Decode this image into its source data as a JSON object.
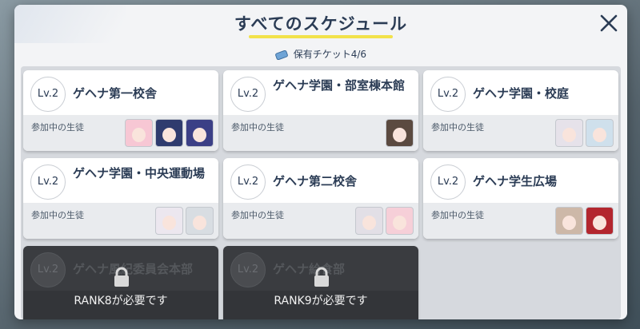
{
  "modal": {
    "title": "すべてのスケジュール",
    "ticket_label": "保有チケット4/6"
  },
  "cards": [
    {
      "level": "Lv.2",
      "title": "ゲヘナ第一校舎",
      "footer": "参加中の生徒",
      "avatars": 3
    },
    {
      "level": "Lv.2",
      "title": "ゲヘナ学園・部室棟本館",
      "footer": "参加中の生徒",
      "avatars": 1
    },
    {
      "level": "Lv.2",
      "title": "ゲヘナ学園・校庭",
      "footer": "参加中の生徒",
      "avatars": 2
    },
    {
      "level": "Lv.2",
      "title": "ゲヘナ学園・中央運動場",
      "footer": "参加中の生徒",
      "avatars": 2
    },
    {
      "level": "Lv.2",
      "title": "ゲヘナ第二校舎",
      "footer": "参加中の生徒",
      "avatars": 2
    },
    {
      "level": "Lv.2",
      "title": "ゲヘナ学生広場",
      "footer": "参加中の生徒",
      "avatars": 2
    }
  ],
  "locked_cards": [
    {
      "level": "Lv.2",
      "title": "ゲヘナ風紀委員会本部",
      "lock_text": "RANK8が必要です"
    },
    {
      "level": "Lv.2",
      "title": "ゲヘナ給食部",
      "lock_text": "RANK9が必要です"
    }
  ],
  "icons": {
    "close": "close-icon",
    "ticket": "ticket-icon",
    "lock": "lock-icon"
  },
  "colors": {
    "title": "#2b3c55",
    "underline": "#f2e24a",
    "heart": "#ff4f86",
    "locked_bg": "#3a3c40"
  }
}
